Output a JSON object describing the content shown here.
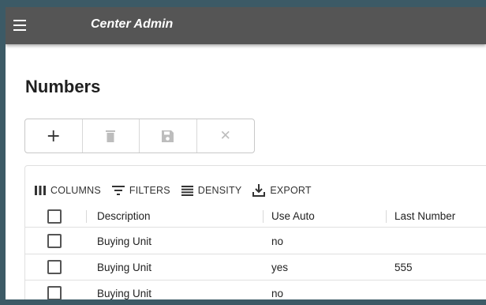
{
  "appbar": {
    "title": "Center Admin",
    "menu_icon": "hamburger-menu-icon"
  },
  "page": {
    "title": "Numbers"
  },
  "toolbar": {
    "buttons": [
      {
        "icon": "add-icon",
        "glyph": "+"
      },
      {
        "icon": "delete-icon"
      },
      {
        "icon": "save-icon"
      },
      {
        "icon": "close-icon",
        "glyph": "✕"
      }
    ]
  },
  "grid_toolbar": {
    "columns_label": "COLUMNS",
    "filters_label": "FILTERS",
    "density_label": "DENSITY",
    "export_label": "EXPORT"
  },
  "table": {
    "headers": [
      "Description",
      "Use Auto",
      "Last Number"
    ],
    "rows": [
      {
        "description": "Buying Unit",
        "use_auto": "no",
        "last_number": ""
      },
      {
        "description": "Buying Unit",
        "use_auto": "yes",
        "last_number": "555"
      },
      {
        "description": "Buying Unit",
        "use_auto": "no",
        "last_number": ""
      }
    ]
  },
  "colors": {
    "appbar": "#555555",
    "backdrop": "#3c5a66",
    "accent_text": "#333333"
  }
}
